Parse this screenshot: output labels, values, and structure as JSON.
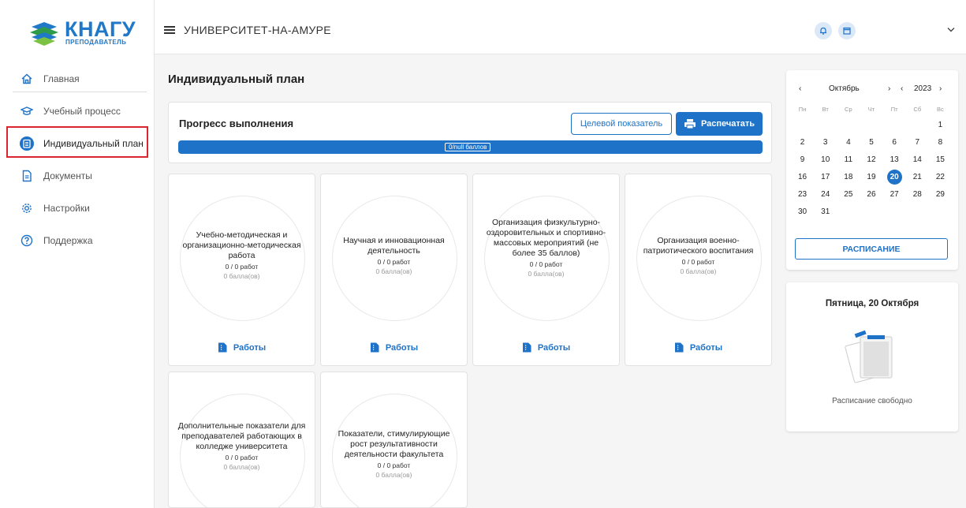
{
  "app": {
    "logo_text": "КНАГУ",
    "logo_sub": "ПРЕПОДАВАТЕЛЬ",
    "header_title": "УНИВЕРСИТЕТ-НА-АМУРЕ",
    "accent_color": "#1e72c8"
  },
  "sidebar": {
    "items": [
      {
        "label": "Главная",
        "icon": "home-icon"
      },
      {
        "label": "Учебный процесс",
        "icon": "graduation-cap-icon"
      },
      {
        "label": "Индивидуальный план",
        "icon": "plan-list-icon",
        "active": true
      },
      {
        "label": "Документы",
        "icon": "document-icon"
      },
      {
        "label": "Настройки",
        "icon": "gear-icon"
      },
      {
        "label": "Поддержка",
        "icon": "help-circle-icon"
      }
    ]
  },
  "main": {
    "page_title": "Индивидуальный план",
    "progress": {
      "title": "Прогресс выполнения",
      "target_button": "Целевой показатель",
      "print_button": "Распечатать",
      "bar_label": "0/null баллов"
    },
    "works_label": "Работы",
    "cards": [
      {
        "name": "Учебно-методическая и организационно-методическая работа",
        "count": "0 / 0 работ",
        "points": "0 балла(ов)"
      },
      {
        "name": "Научная и инновационная деятельность",
        "count": "0 / 0 работ",
        "points": "0 балла(ов)"
      },
      {
        "name": "Организация физкультурно-оздоровительных и спортивно-массовых мероприятий (не более 35 баллов)",
        "count": "0 / 0 работ",
        "points": "0 балла(ов)"
      },
      {
        "name": "Организация военно-патриотического воспитания",
        "count": "0 / 0 работ",
        "points": "0 балла(ов)"
      },
      {
        "name": "Дополнительные показатели для преподавателей работающих в колледже университета",
        "count": "0 / 0 работ",
        "points": "0 балла(ов)"
      },
      {
        "name": "Показатели, стимулирующие рост результативности деятельности факультета",
        "count": "0 / 0 работ",
        "points": "0 балла(ов)"
      }
    ]
  },
  "calendar": {
    "prev_month": "‹",
    "month": "Октябрь",
    "next_month": "›",
    "prev_year": "‹",
    "year": "2023",
    "next_year": "›",
    "weekdays": [
      "Пн",
      "Вт",
      "Ср",
      "Чт",
      "Пт",
      "Сб",
      "Вс"
    ],
    "days": [
      "",
      "",
      "",
      "",
      "",
      "",
      "1",
      "2",
      "3",
      "4",
      "5",
      "6",
      "7",
      "8",
      "9",
      "10",
      "11",
      "12",
      "13",
      "14",
      "15",
      "16",
      "17",
      "18",
      "19",
      "20",
      "21",
      "22",
      "23",
      "24",
      "25",
      "26",
      "27",
      "28",
      "29",
      "30",
      "31"
    ],
    "today": "20",
    "schedule_button": "РАСПИСАНИЕ"
  },
  "day_panel": {
    "title": "Пятница, 20 Октября",
    "empty_text": "Расписание свободно"
  }
}
